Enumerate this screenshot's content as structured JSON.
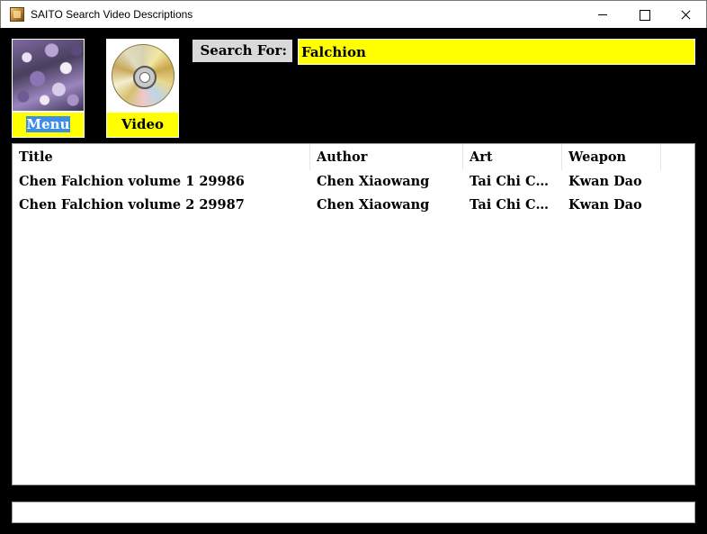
{
  "window": {
    "title": "SAITO Search Video Descriptions"
  },
  "tiles": {
    "menu_label": "Menu",
    "video_label": "Video"
  },
  "search": {
    "label": "Search For:",
    "value": "Falchion"
  },
  "table": {
    "columns": [
      "Title",
      "Author",
      "Art",
      "Weapon"
    ],
    "rows": [
      {
        "title": "Chen Falchion volume 1 29986",
        "author": "Chen Xiaowang",
        "art": "Tai Chi Chuan",
        "weapon": "Kwan Dao"
      },
      {
        "title": "Chen Falchion volume 2 29987",
        "author": "Chen Xiaowang",
        "art": "Tai Chi Chuan",
        "weapon": "Kwan Dao"
      }
    ]
  },
  "status": {
    "text": ""
  },
  "colors": {
    "accent_yellow": "#ffff00",
    "background": "#000000",
    "selection": "#3d8ee6"
  }
}
